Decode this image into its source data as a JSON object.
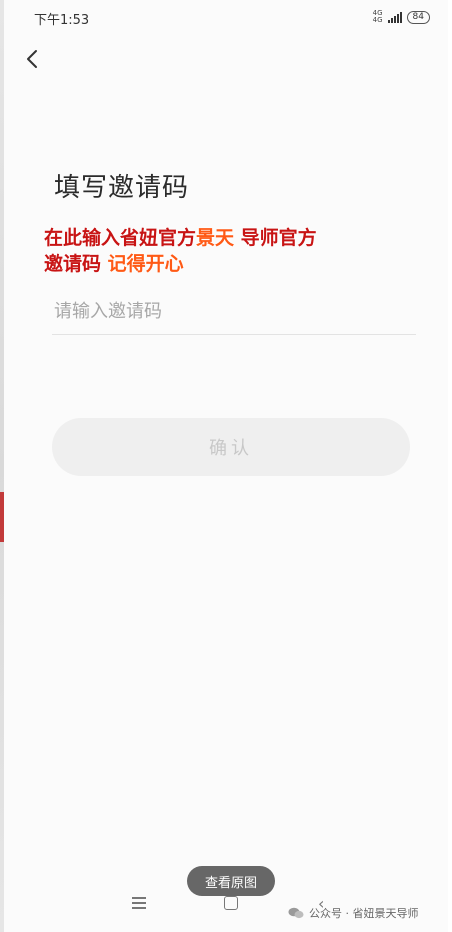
{
  "status_bar": {
    "time": "下午1:53",
    "network_top": "4G",
    "network_bottom": "4G",
    "battery": "84"
  },
  "page": {
    "title": "填写邀请码",
    "overlay_text": {
      "part1": "在此输入省妞官方",
      "highlight1": "景天",
      "part2": " 导师官方",
      "part3": "邀请码 ",
      "highlight2": "记得开心"
    },
    "invite_input": {
      "placeholder": "请输入邀请码",
      "value": ""
    },
    "confirm_label": "确认"
  },
  "bottom": {
    "view_original_label": "查看原图",
    "watermark": "公众号 · 省妞景天导师"
  },
  "colors": {
    "overlay_red": "#c81414",
    "overlay_orange": "#ff5a16",
    "button_disabled_bg": "#efefef"
  }
}
